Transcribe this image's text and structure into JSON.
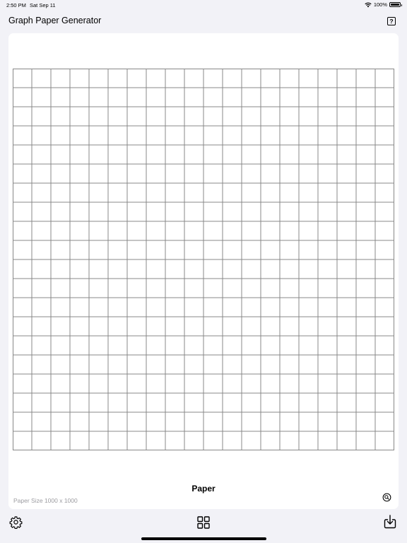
{
  "status_bar": {
    "time": "2:50 PM",
    "date": "Sat Sep 11",
    "battery": "100%"
  },
  "nav": {
    "title": "Graph Paper Generator",
    "help_icon": "question-square-icon",
    "help_label": "?"
  },
  "paper": {
    "label": "Paper",
    "size_text": "Paper Size 1000 x 1000",
    "grid_cells": 20,
    "grid_color": "#888888",
    "zoom_icon": "magnifier-icon"
  },
  "toolbar": {
    "settings_icon": "gear-icon",
    "templates_icon": "grid-four-squares-icon",
    "export_icon": "download-tray-icon"
  },
  "colors": {
    "background": "#f2f2f7",
    "card": "#ffffff",
    "secondary_text": "#9b9ba0"
  }
}
